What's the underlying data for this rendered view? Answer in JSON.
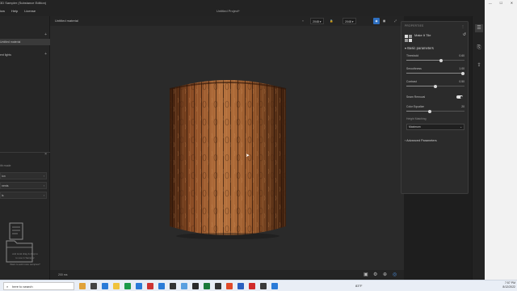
{
  "window": {
    "app_title": "3D Sampler (Substance Edition)",
    "controls": [
      "—",
      "☐",
      "✕"
    ]
  },
  "menu": {
    "items": [
      "iow",
      "Help",
      "License"
    ],
    "project_title": "Untitled Project*"
  },
  "left_panel": {
    "material_section_plus": "+",
    "selected_item": "Untitled material",
    "env_item": "ent lights",
    "env_plus": "+",
    "layers_label": "ith mode",
    "layers_close": "×",
    "layer_boxes": [
      "ion",
      "nents",
      "ls"
    ],
    "drop_hint_1": "and local drag & drop to",
    "drop_hint_2": "to use in Sampler",
    "drop_hint_3": "Want to add more samples?"
  },
  "viewport": {
    "tab_title": "Untitled material",
    "resolution_1": "2048",
    "resolution_2": "2048",
    "zoom_label": "200 ms"
  },
  "properties": {
    "title": "PROPERTIES",
    "filter_name": "Make It Tile",
    "basic_section": "Basic parameters",
    "params": [
      {
        "label": "Threshold",
        "value": "0.60",
        "fraction": 0.6
      },
      {
        "label": "Smoothness",
        "value": "1.00",
        "fraction": 1.0
      },
      {
        "label": "Contrast",
        "value": "0.50",
        "fraction": 0.5
      }
    ],
    "seam_removal_label": "Seam Removal",
    "color_eq_label": "Color Equalize",
    "color_eq_value": "20",
    "color_eq_fraction": 0.4,
    "height_matching_label": "Height Matching",
    "height_matching_value": "Maximum",
    "advanced_section": "Advanced Parameters"
  },
  "taskbar": {
    "search_text": "here to search",
    "weather": "83°F",
    "time": "7:57 PM",
    "date": "8/12/2022"
  },
  "colors": {
    "accent": "#4a8bd6",
    "wood_dark": "#6b3a1c",
    "wood_light": "#b26f3d"
  }
}
